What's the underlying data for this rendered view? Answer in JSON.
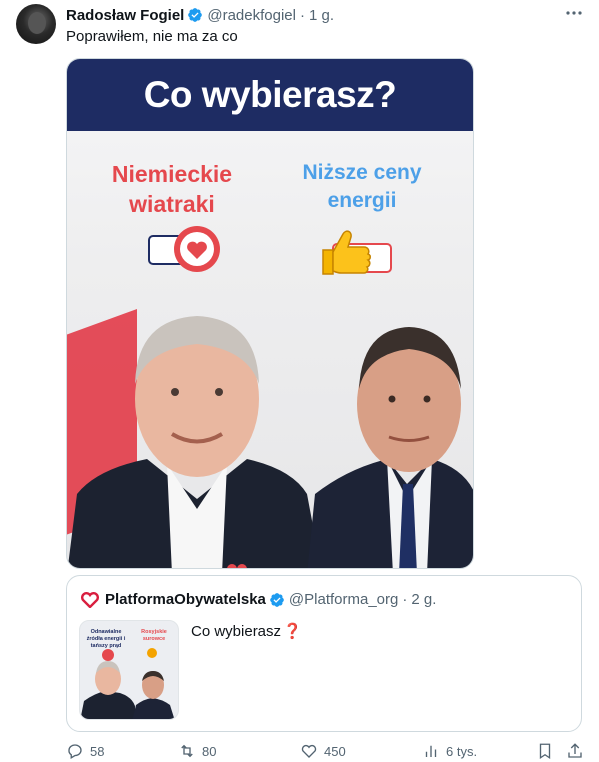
{
  "tweet": {
    "author_name": "Radosław Fogiel",
    "handle": "@radekfogiel",
    "separator": "·",
    "time": "1 g.",
    "text": "Poprawiłem, nie ma za co",
    "more_icon": "more-dots-icon",
    "verified_icon": "verified-badge-icon"
  },
  "media": {
    "title": "Co wybierasz?",
    "option_left": "Niemieckie wiatraki",
    "option_right": "Niższe ceny energii",
    "colors": {
      "banner": "#1e2c63",
      "left": "#e5484d",
      "right": "#4da0e8"
    }
  },
  "quote": {
    "author_name": "PlatformaObywatelska",
    "handle": "@Platforma_org",
    "separator": "·",
    "time": "2 g.",
    "text": "Co wybierasz",
    "emoji": "❓",
    "thumb_left": "Odnawialne źródła energii i tańszy prąd",
    "thumb_right": "Rosyjskie surowce"
  },
  "actions": {
    "reply_count": "58",
    "retweet_count": "80",
    "like_count": "450",
    "views_count": "6 tys."
  }
}
